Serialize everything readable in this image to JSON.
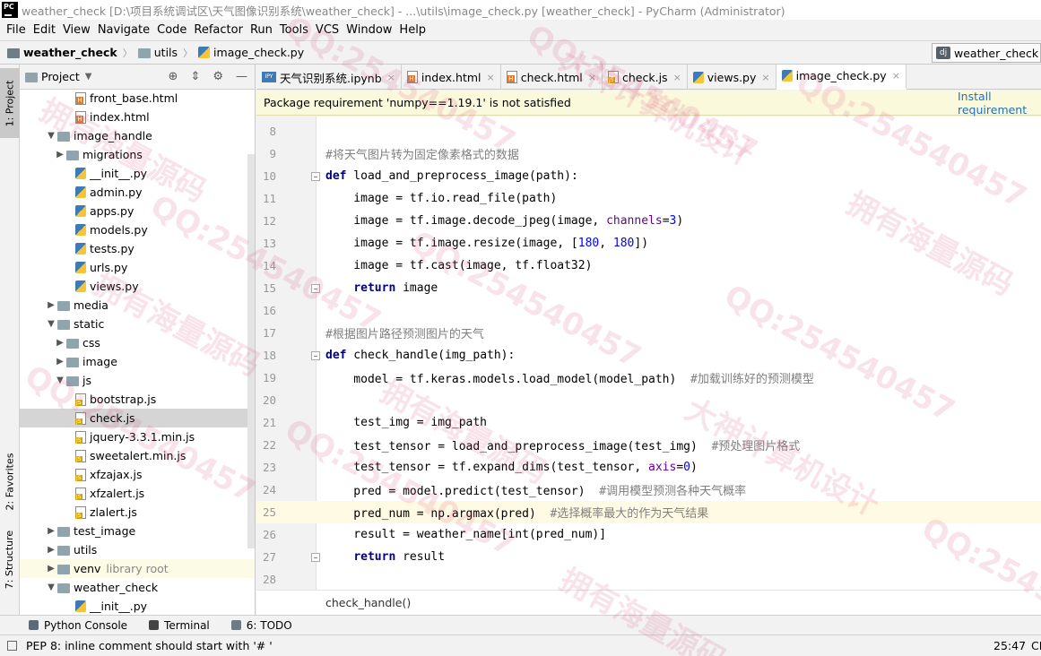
{
  "window": {
    "title": "weather_check [D:\\项目系统调试区\\天气图像识别系统\\weather_check] - ...\\utils\\image_check.py [weather_check] - PyCharm (Administrator)",
    "logo_text": "PC"
  },
  "menu": [
    "File",
    "Edit",
    "View",
    "Navigate",
    "Code",
    "Refactor",
    "Run",
    "Tools",
    "VCS",
    "Window",
    "Help"
  ],
  "navbar": {
    "crumbs": [
      "weather_check",
      "utils",
      "image_check.py"
    ],
    "run_config": "weather_check"
  },
  "left_strip": {
    "project_tab": "1: Project",
    "favorites_tab": "2: Favorites",
    "structure_tab": "7: Structure"
  },
  "project_panel": {
    "title": "Project",
    "tree": [
      {
        "label": "front_base.html",
        "type": "html"
      },
      {
        "label": "index.html",
        "type": "html"
      },
      {
        "label": "image_handle",
        "type": "folder",
        "expanded": true
      },
      {
        "label": "migrations",
        "type": "folder",
        "expanded": false
      },
      {
        "label": "__init__.py",
        "type": "py"
      },
      {
        "label": "admin.py",
        "type": "py"
      },
      {
        "label": "apps.py",
        "type": "py"
      },
      {
        "label": "models.py",
        "type": "py"
      },
      {
        "label": "tests.py",
        "type": "py"
      },
      {
        "label": "urls.py",
        "type": "py"
      },
      {
        "label": "views.py",
        "type": "py"
      },
      {
        "label": "media",
        "type": "folder",
        "expanded": false
      },
      {
        "label": "static",
        "type": "folder",
        "expanded": true
      },
      {
        "label": "css",
        "type": "folder",
        "expanded": false
      },
      {
        "label": "image",
        "type": "folder",
        "expanded": false
      },
      {
        "label": "js",
        "type": "folder",
        "expanded": true
      },
      {
        "label": "bootstrap.js",
        "type": "js"
      },
      {
        "label": "check.js",
        "type": "js",
        "selected": true
      },
      {
        "label": "jquery-3.3.1.min.js",
        "type": "js"
      },
      {
        "label": "sweetalert.min.js",
        "type": "js"
      },
      {
        "label": "xfzajax.js",
        "type": "js"
      },
      {
        "label": "xfzalert.js",
        "type": "js"
      },
      {
        "label": "zlalert.js",
        "type": "js"
      },
      {
        "label": "test_image",
        "type": "folder",
        "expanded": false
      },
      {
        "label": "utils",
        "type": "folder",
        "expanded": false
      },
      {
        "label": "venv",
        "type": "folder",
        "expanded": false,
        "note": "library root"
      },
      {
        "label": "weather_check",
        "type": "folder",
        "expanded": true
      },
      {
        "label": "__init__.py",
        "type": "py"
      }
    ]
  },
  "tabs": [
    {
      "label": "天气识别系统.ipynb",
      "type": "ipynb"
    },
    {
      "label": "index.html",
      "type": "html"
    },
    {
      "label": "check.html",
      "type": "html"
    },
    {
      "label": "check.js",
      "type": "js"
    },
    {
      "label": "views.py",
      "type": "py"
    },
    {
      "label": "image_check.py",
      "type": "py",
      "active": true
    }
  ],
  "notice": {
    "message": "Package requirement 'numpy==1.19.1' is not satisfied",
    "action": "Install requirement"
  },
  "code_lines": [
    {
      "n": "8",
      "text": ""
    },
    {
      "n": "9",
      "text": "#将天气图片转为固定像素格式的数据"
    },
    {
      "n": "10",
      "text": "def load_and_preprocess_image(path):"
    },
    {
      "n": "11",
      "text": "    image = tf.io.read_file(path)"
    },
    {
      "n": "12",
      "text": "    image = tf.image.decode_jpeg(image, channels=3)"
    },
    {
      "n": "13",
      "text": "    image = tf.image.resize(image, [180, 180])"
    },
    {
      "n": "14",
      "text": "    image = tf.cast(image, tf.float32)"
    },
    {
      "n": "15",
      "text": "    return image"
    },
    {
      "n": "16",
      "text": ""
    },
    {
      "n": "17",
      "text": "#根据图片路径预测图片的天气"
    },
    {
      "n": "18",
      "text": "def check_handle(img_path):"
    },
    {
      "n": "19",
      "text": "    model = tf.keras.models.load_model(model_path)  #加载训练好的预测模型"
    },
    {
      "n": "20",
      "text": ""
    },
    {
      "n": "21",
      "text": "    test_img = img_path"
    },
    {
      "n": "22",
      "text": "    test_tensor = load_and_preprocess_image(test_img)  #预处理图片格式"
    },
    {
      "n": "23",
      "text": "    test_tensor = tf.expand_dims(test_tensor, axis=0)"
    },
    {
      "n": "24",
      "text": "    pred = model.predict(test_tensor)  #调用模型预测各种天气概率"
    },
    {
      "n": "25",
      "text": "    pred_num = np.argmax(pred)  #选择概率最大的作为天气结果"
    },
    {
      "n": "26",
      "text": "    result = weather_name[int(pred_num)]"
    },
    {
      "n": "27",
      "text": "    return result"
    },
    {
      "n": "28",
      "text": ""
    }
  ],
  "editor_breadcrumb": "check_handle()",
  "bottom_tools": [
    {
      "label": "Python Console",
      "icon": "python-console-icon"
    },
    {
      "label": "Terminal",
      "icon": "terminal-icon"
    },
    {
      "label": "6: TODO",
      "icon": "todo-icon"
    }
  ],
  "status": {
    "message": "PEP 8: inline comment should start with '# '",
    "position": "25:47",
    "line_sep": "CR"
  },
  "watermarks": [
    "拥有海量源码",
    "QQ:254540457",
    "大神计算机设计"
  ],
  "colors": {
    "keyword": "#000080",
    "number": "#0000ff",
    "kwarg": "#660099",
    "comment": "#808080",
    "notice_bg": "#fbf9dc",
    "link": "#2470b3"
  }
}
